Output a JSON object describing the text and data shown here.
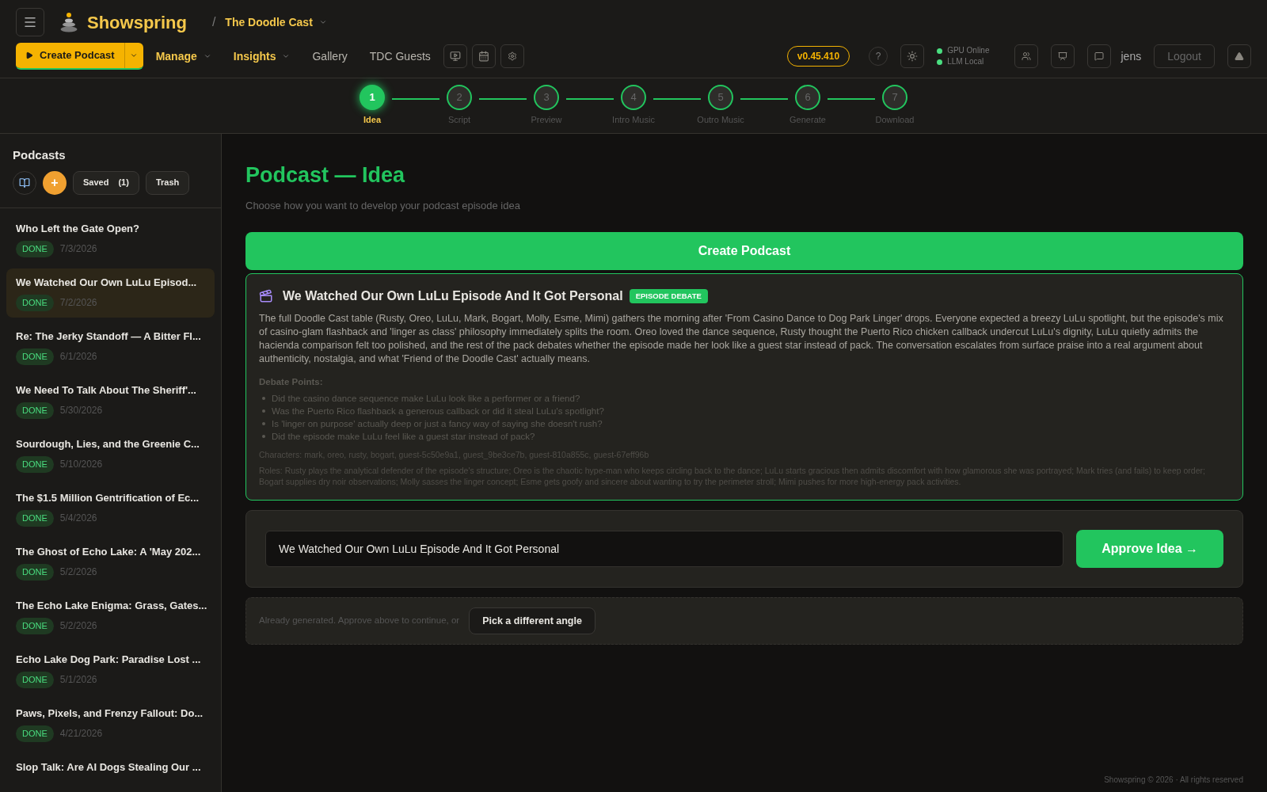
{
  "header": {
    "brand": "Showspring",
    "breadcrumb_separator": "/",
    "show_name": "The Doodle Cast",
    "create_button": "Create Podcast",
    "nav": [
      {
        "label": "Manage",
        "dropdown": true,
        "highlight": true
      },
      {
        "label": "Insights",
        "dropdown": true,
        "highlight": true
      },
      {
        "label": "Gallery",
        "dropdown": false,
        "highlight": false
      },
      {
        "label": "TDC Guests",
        "dropdown": false,
        "highlight": false
      }
    ],
    "version": "v0.45.410",
    "help": "?",
    "status": [
      {
        "label": "GPU Online",
        "color": "#4ade80"
      },
      {
        "label": "LLM Local",
        "color": "#4ade80"
      }
    ],
    "user": "jens",
    "logout": "Logout"
  },
  "stepper": [
    {
      "number": "1",
      "label": "Idea",
      "selected": true
    },
    {
      "number": "2",
      "label": "Script",
      "selected": false
    },
    {
      "number": "3",
      "label": "Preview",
      "selected": false
    },
    {
      "number": "4",
      "label": "Intro Music",
      "selected": false
    },
    {
      "number": "5",
      "label": "Outro Music",
      "selected": false
    },
    {
      "number": "6",
      "label": "Generate",
      "selected": false
    },
    {
      "number": "7",
      "label": "Download",
      "selected": false
    }
  ],
  "sidebar": {
    "title": "Podcasts",
    "add": "+",
    "saved": "Saved",
    "saved_count": "(1)",
    "trash": "Trash",
    "items": [
      {
        "title": "Who Left the Gate Open?",
        "status": "DONE",
        "date": "7/3/2026",
        "selected": false
      },
      {
        "title": "We Watched Our Own LuLu Episod...",
        "status": "DONE",
        "date": "7/2/2026",
        "selected": true
      },
      {
        "title": "Re: The Jerky Standoff — A Bitter Fl...",
        "status": "DONE",
        "date": "6/1/2026",
        "selected": false
      },
      {
        "title": "We Need To Talk About The Sheriff'...",
        "status": "DONE",
        "date": "5/30/2026",
        "selected": false
      },
      {
        "title": "Sourdough, Lies, and the Greenie C...",
        "status": "DONE",
        "date": "5/10/2026",
        "selected": false
      },
      {
        "title": "The $1.5 Million Gentrification of Ec...",
        "status": "DONE",
        "date": "5/4/2026",
        "selected": false
      },
      {
        "title": "The Ghost of Echo Lake: A 'May 202...",
        "status": "DONE",
        "date": "5/2/2026",
        "selected": false
      },
      {
        "title": "The Echo Lake Enigma: Grass, Gates...",
        "status": "DONE",
        "date": "5/2/2026",
        "selected": false
      },
      {
        "title": "Echo Lake Dog Park: Paradise Lost ...",
        "status": "DONE",
        "date": "5/1/2026",
        "selected": false
      },
      {
        "title": "Paws, Pixels, and Frenzy Fallout: Do...",
        "status": "DONE",
        "date": "4/21/2026",
        "selected": false
      },
      {
        "title": "Slop Talk: Are AI Dogs Stealing Our ...",
        "selected": false
      }
    ]
  },
  "main": {
    "title": "Podcast — Idea",
    "subtitle": "Choose how you want to develop your podcast episode idea",
    "create_button": "Create Podcast",
    "idea": {
      "title": "We Watched Our Own LuLu Episode And It Got Personal",
      "badge": "EPISODE DEBATE",
      "description": "The full Doodle Cast table (Rusty, Oreo, LuLu, Mark, Bogart, Molly, Esme, Mimi) gathers the morning after 'From Casino Dance to Dog Park Linger' drops. Everyone expected a breezy LuLu spotlight, but the episode's mix of casino-glam flashback and 'linger as class' philosophy immediately splits the room. Oreo loved the dance sequence, Rusty thought the Puerto Rico chicken callback undercut LuLu's dignity, LuLu quietly admits the hacienda comparison felt too polished, and the rest of the pack debates whether the episode made her look like a guest star instead of pack. The conversation escalates from surface praise into a real argument about authenticity, nostalgia, and what 'Friend of the Doodle Cast' actually means.",
      "points_label": "Debate Points:",
      "points": [
        "Did the casino dance sequence make LuLu look like a performer or a friend?",
        "Was the Puerto Rico flashback a generous callback or did it steal LuLu's spotlight?",
        "Is 'linger on purpose' actually deep or just a fancy way of saying she doesn't rush?",
        "Did the episode make LuLu feel like a guest star instead of pack?"
      ],
      "characters": "Characters: mark, oreo, rusty, bogart, guest-5c50e9a1, guest_9be3ce7b, guest-810a855c, guest-67eff96b",
      "roles": "Roles: Rusty plays the analytical defender of the episode's structure; Oreo is the chaotic hype-man who keeps circling back to the dance; LuLu starts gracious then admits discomfort with how glamorous she was portrayed; Mark tries (and fails) to keep order; Bogart supplies dry noir observations; Molly sasses the linger concept; Esme gets goofy and sincere about wanting to try the perimeter stroll; Mimi pushes for more high-energy pack activities."
    },
    "title_input": {
      "value": "We Watched Our Own LuLu Episode And It Got Personal"
    },
    "approve": "Approve Idea →",
    "note": "Already generated. Approve above to continue, or",
    "alt_button": "Pick a different angle"
  },
  "footer": "Showspring © 2026 · All rights reserved"
}
